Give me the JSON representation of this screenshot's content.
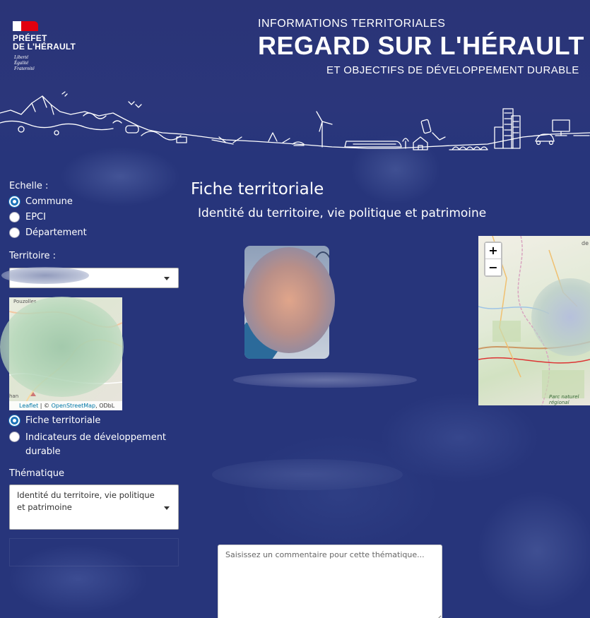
{
  "header": {
    "logo": {
      "title_line1": "PRÉFET",
      "title_line2": "DE L'HÉRAULT",
      "motto": [
        "Liberté",
        "Égalité",
        "Fraternité"
      ]
    },
    "kicker": "INFORMATIONS TERRITORIALES",
    "title": "REGARD SUR L'HÉRAULT",
    "subtitle": "ET OBJECTIFS DE DÉVELOPPEMENT DURABLE"
  },
  "sidebar": {
    "echelle_label": "Echelle :",
    "echelle_options": [
      {
        "label": "Commune",
        "selected": true
      },
      {
        "label": "EPCI",
        "selected": false
      },
      {
        "label": "Département",
        "selected": false
      }
    ],
    "territoire_label": "Territoire :",
    "territoire_value": "",
    "minimap": {
      "place_top": "Pouzolles",
      "place_bottom": "han",
      "attribution_leaflet": "Leaflet",
      "attribution_sep": " | © ",
      "attribution_osm": "OpenStreetMap",
      "attribution_odbl": ", ODbL"
    },
    "view_options": [
      {
        "label": "Fiche territoriale",
        "selected": true
      },
      {
        "label": "Indicateurs de développement durable",
        "selected": false
      }
    ],
    "thematique_label": "Thématique",
    "thematique_value": "Identité du territoire, vie politique et patrimoine"
  },
  "main": {
    "title": "Fiche territoriale",
    "subtitle": "Identité du territoire, vie politique et patrimoine",
    "map": {
      "zoom_in": "+",
      "zoom_out": "−",
      "label_top": "de",
      "label_bottom": "Parc naturel régional"
    },
    "comment_placeholder": "Saisissez un commentaire pour cette thématique..."
  },
  "colors": {
    "background": "#27357b",
    "radio_accent": "#1b73b8",
    "marianne_red": "#e1000f"
  }
}
